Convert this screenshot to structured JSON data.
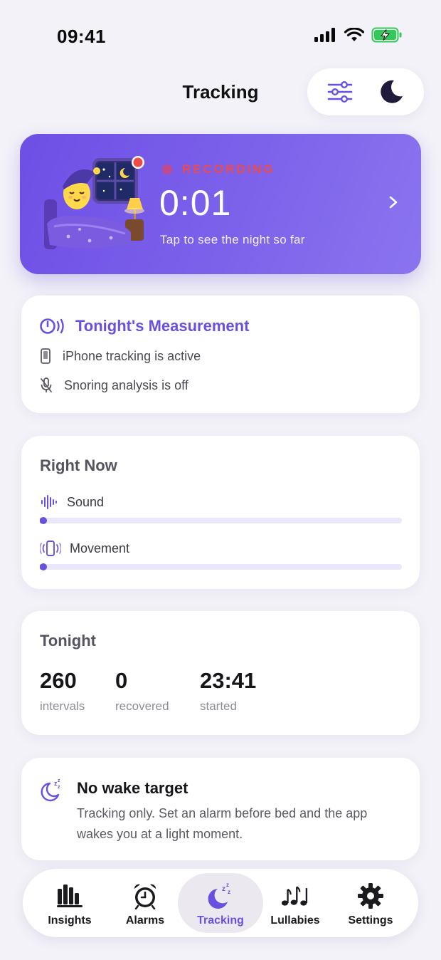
{
  "status_bar": {
    "time": "09:41"
  },
  "header": {
    "title": "Tracking",
    "filters_icon": "sliders-icon",
    "sleep_mode_icon": "moon-icon"
  },
  "recording": {
    "status": "RECORDING",
    "timer": "0:01",
    "subtitle": "Tap to see the night so far",
    "accent_color": "#6e4fe6",
    "status_color": "#ef4a4a"
  },
  "measurement": {
    "title": "Tonight's Measurement",
    "lines": [
      {
        "icon": "iphone-icon",
        "text": "iPhone tracking is active"
      },
      {
        "icon": "mic-off-icon",
        "text": "Snoring analysis is off"
      }
    ]
  },
  "right_now": {
    "title": "Right Now",
    "meters": [
      {
        "icon": "waveform-icon",
        "label": "Sound",
        "level": 0.01
      },
      {
        "icon": "phone-vibrate-icon",
        "label": "Movement",
        "level": 0.01
      }
    ]
  },
  "tonight": {
    "title": "Tonight",
    "stats": [
      {
        "value": "260",
        "label": "intervals"
      },
      {
        "value": "0",
        "label": "recovered"
      },
      {
        "value": "23:41",
        "label": "started"
      }
    ]
  },
  "wake": {
    "icon": "moon-zzz-icon",
    "title": "No wake target",
    "text": "Tracking only. Set an alarm before bed and the app wakes you at a light moment."
  },
  "tabs": [
    {
      "label": "Insights",
      "icon": "bar-chart-icon",
      "active": false
    },
    {
      "label": "Alarms",
      "icon": "alarm-clock-icon",
      "active": false
    },
    {
      "label": "Tracking",
      "icon": "moon-zzz-icon",
      "active": true
    },
    {
      "label": "Lullabies",
      "icon": "music-notes-icon",
      "active": false
    },
    {
      "label": "Settings",
      "icon": "gear-icon",
      "active": false
    }
  ],
  "colors": {
    "accent": "#6a4fe0",
    "background": "#f3f2f8",
    "battery": "#34c759"
  }
}
